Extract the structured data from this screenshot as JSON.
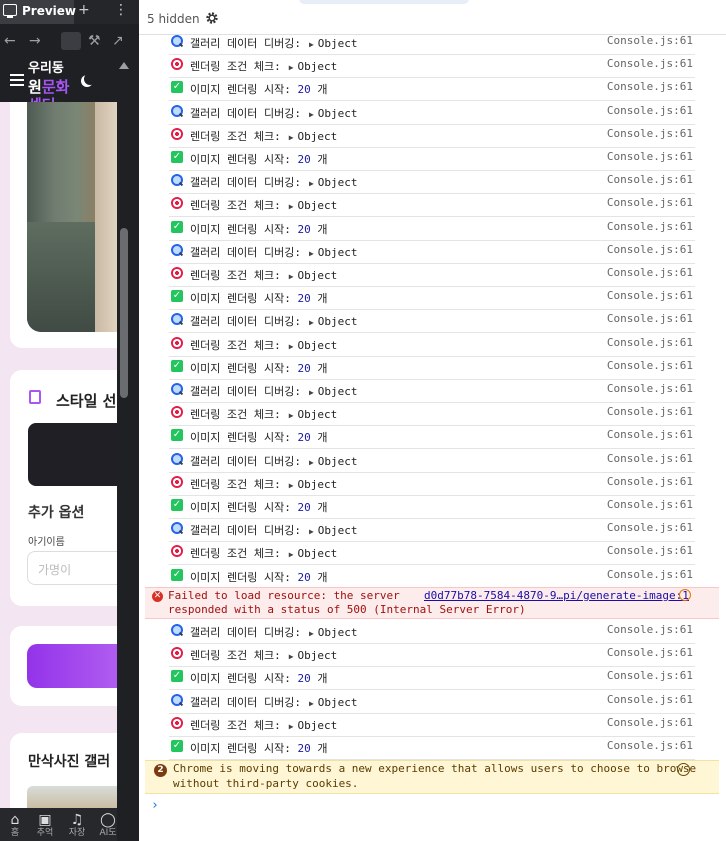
{
  "left_panel": {
    "tab_title": "Preview",
    "new_tab_glyph": "+",
    "more_glyph": "⋮",
    "nav_back_glyph": "←",
    "nav_forward_glyph": "→",
    "nav_tools_glyph": "⚒",
    "nav_open_glyph": "↗",
    "app_title_cut": "우리동",
    "app_title_a": "원",
    "app_title_b": "문화",
    "app_title_c": "센터",
    "style_heading": "스타일 선",
    "extra_options": "추가 옵션",
    "baby_name_label": "아기이름",
    "baby_name_placeholder": "가명이",
    "gallery_heading": "만삭사진 갤러",
    "bottom_nav": [
      {
        "icon": "home-icon",
        "glyph": "⌂",
        "label": "홈"
      },
      {
        "icon": "image-icon",
        "glyph": "▣",
        "label": "추억"
      },
      {
        "icon": "music-icon",
        "glyph": "♫",
        "label": "자장"
      },
      {
        "icon": "chat-icon",
        "glyph": "◯",
        "label": "AI도"
      }
    ]
  },
  "console": {
    "hidden_count": "5 hidden",
    "rows_top": [
      {
        "icon": "magnifier",
        "label": "갤러리 데이터 디버깅:",
        "value": "Object",
        "src": "Console.js:61"
      },
      {
        "icon": "target",
        "label": "렌더링 조건 체크:",
        "value": "Object",
        "src": "Console.js:61"
      },
      {
        "icon": "check",
        "label": "이미지 렌더링 시작:",
        "num": "20",
        "unit": "개",
        "src": "Console.js:61"
      },
      {
        "icon": "magnifier",
        "label": "갤러리 데이터 디버깅:",
        "value": "Object",
        "src": "Console.js:61"
      },
      {
        "icon": "target",
        "label": "렌더링 조건 체크:",
        "value": "Object",
        "src": "Console.js:61"
      },
      {
        "icon": "check",
        "label": "이미지 렌더링 시작:",
        "num": "20",
        "unit": "개",
        "src": "Console.js:61"
      },
      {
        "icon": "magnifier",
        "label": "갤러리 데이터 디버깅:",
        "value": "Object",
        "src": "Console.js:61"
      },
      {
        "icon": "target",
        "label": "렌더링 조건 체크:",
        "value": "Object",
        "src": "Console.js:61"
      },
      {
        "icon": "check",
        "label": "이미지 렌더링 시작:",
        "num": "20",
        "unit": "개",
        "src": "Console.js:61"
      },
      {
        "icon": "magnifier",
        "label": "갤러리 데이터 디버깅:",
        "value": "Object",
        "src": "Console.js:61"
      },
      {
        "icon": "target",
        "label": "렌더링 조건 체크:",
        "value": "Object",
        "src": "Console.js:61"
      },
      {
        "icon": "check",
        "label": "이미지 렌더링 시작:",
        "num": "20",
        "unit": "개",
        "src": "Console.js:61"
      },
      {
        "icon": "magnifier",
        "label": "갤러리 데이터 디버깅:",
        "value": "Object",
        "src": "Console.js:61"
      },
      {
        "icon": "target",
        "label": "렌더링 조건 체크:",
        "value": "Object",
        "src": "Console.js:61"
      },
      {
        "icon": "check",
        "label": "이미지 렌더링 시작:",
        "num": "20",
        "unit": "개",
        "src": "Console.js:61"
      },
      {
        "icon": "magnifier",
        "label": "갤러리 데이터 디버깅:",
        "value": "Object",
        "src": "Console.js:61"
      },
      {
        "icon": "target",
        "label": "렌더링 조건 체크:",
        "value": "Object",
        "src": "Console.js:61"
      },
      {
        "icon": "check",
        "label": "이미지 렌더링 시작:",
        "num": "20",
        "unit": "개",
        "src": "Console.js:61"
      },
      {
        "icon": "magnifier",
        "label": "갤러리 데이터 디버깅:",
        "value": "Object",
        "src": "Console.js:61"
      },
      {
        "icon": "target",
        "label": "렌더링 조건 체크:",
        "value": "Object",
        "src": "Console.js:61"
      },
      {
        "icon": "check",
        "label": "이미지 렌더링 시작:",
        "num": "20",
        "unit": "개",
        "src": "Console.js:61"
      },
      {
        "icon": "magnifier",
        "label": "갤러리 데이터 디버깅:",
        "value": "Object",
        "src": "Console.js:61"
      },
      {
        "icon": "target",
        "label": "렌더링 조건 체크:",
        "value": "Object",
        "src": "Console.js:61"
      },
      {
        "icon": "check",
        "label": "이미지 렌더링 시작:",
        "num": "20",
        "unit": "개",
        "src": "Console.js:61"
      }
    ],
    "error": {
      "line1": "Failed to load resource: the server",
      "line2": "responded with a status of 500 (Internal Server Error)",
      "link": "d0d77b78-7584-4870-9…pi/generate-image:1",
      "icon_glyph": "✕"
    },
    "rows_bottom": [
      {
        "icon": "magnifier",
        "label": "갤러리 데이터 디버깅:",
        "value": "Object",
        "src": "Console.js:61"
      },
      {
        "icon": "target",
        "label": "렌더링 조건 체크:",
        "value": "Object",
        "src": "Console.js:61"
      },
      {
        "icon": "check",
        "label": "이미지 렌더링 시작:",
        "num": "20",
        "unit": "개",
        "src": "Console.js:61"
      },
      {
        "icon": "magnifier",
        "label": "갤러리 데이터 디버깅:",
        "value": "Object",
        "src": "Console.js:61"
      },
      {
        "icon": "target",
        "label": "렌더링 조건 체크:",
        "value": "Object",
        "src": "Console.js:61"
      },
      {
        "icon": "check",
        "label": "이미지 렌더링 시작:",
        "num": "20",
        "unit": "개",
        "src": "Console.js:61"
      }
    ],
    "warning": {
      "badge": "2",
      "line1": "Chrome is moving towards a new experience that allows users to choose to browse",
      "line2": "without third-party cookies."
    },
    "prompt_glyph": "›",
    "check_glyph": "✓",
    "expand_glyph": "▶"
  }
}
